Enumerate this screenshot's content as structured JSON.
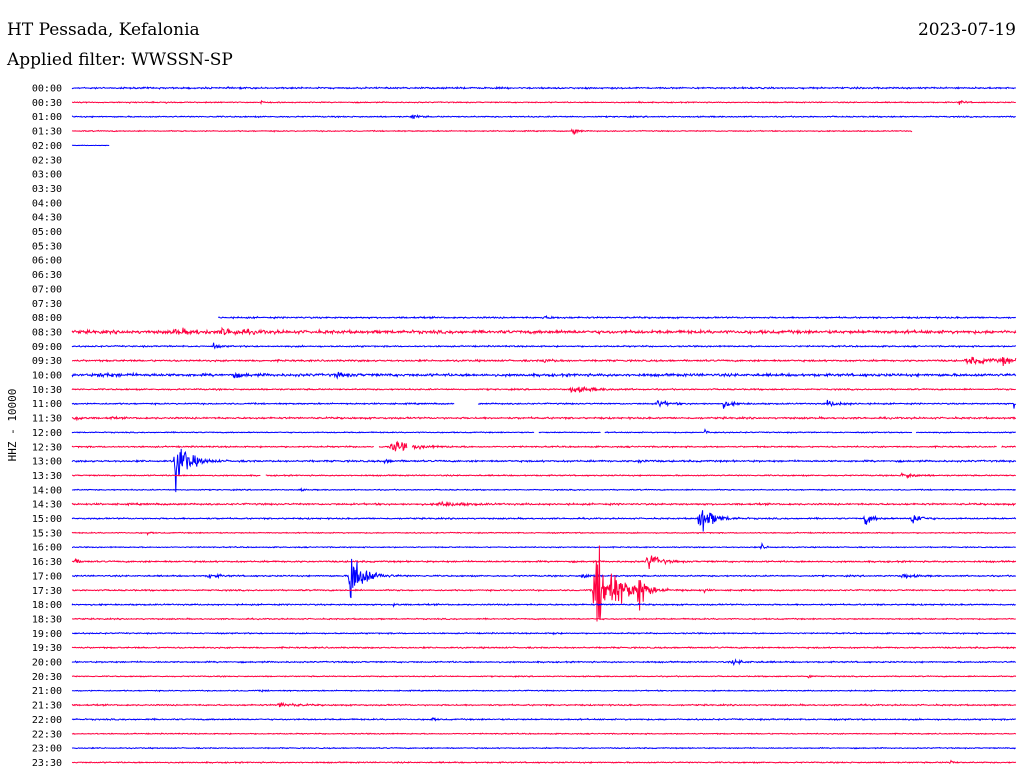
{
  "header": {
    "station": "HT Pessada, Kefalonia",
    "date": "2023-07-19",
    "filter": "Applied filter: WWSSN-SP"
  },
  "chart_data": {
    "type": "line",
    "title": "",
    "ylabel": "HHZ - 10000",
    "colors": [
      "#0000ff",
      "#ff0040"
    ],
    "grid": false,
    "rows": [
      {
        "label": "00:00",
        "start": 0.0,
        "end": 1.0,
        "noise": 0.9,
        "events": [],
        "gaps": []
      },
      {
        "label": "00:30",
        "start": 0.0,
        "end": 1.0,
        "noise": 0.6,
        "events": [
          {
            "t": 0.06,
            "amp": 2,
            "dur": 0.004
          },
          {
            "t": 0.1,
            "amp": 2,
            "dur": 0.004
          },
          {
            "t": 0.2,
            "amp": 2,
            "dur": 0.004
          },
          {
            "t": 0.6,
            "amp": 2,
            "dur": 0.004
          },
          {
            "t": 0.94,
            "amp": 3,
            "dur": 0.01
          }
        ],
        "gaps": []
      },
      {
        "label": "01:00",
        "start": 0.0,
        "end": 1.0,
        "noise": 0.7,
        "events": [
          {
            "t": 0.36,
            "amp": 5,
            "dur": 0.01
          }
        ],
        "gaps": []
      },
      {
        "label": "01:30",
        "start": 0.0,
        "end": 0.89,
        "noise": 0.6,
        "events": [
          {
            "t": 0.53,
            "amp": 6,
            "dur": 0.01
          }
        ],
        "gaps": []
      },
      {
        "label": "02:00",
        "start": 0.0,
        "end": 0.04,
        "noise": 0.3,
        "events": [],
        "gaps": []
      },
      {
        "label": "02:30",
        "start": 0,
        "end": 0,
        "noise": 0,
        "events": [],
        "gaps": []
      },
      {
        "label": "03:00",
        "start": 0,
        "end": 0,
        "noise": 0,
        "events": [],
        "gaps": []
      },
      {
        "label": "03:30",
        "start": 0,
        "end": 0,
        "noise": 0,
        "events": [],
        "gaps": []
      },
      {
        "label": "04:00",
        "start": 0,
        "end": 0,
        "noise": 0,
        "events": [],
        "gaps": []
      },
      {
        "label": "04:30",
        "start": 0,
        "end": 0,
        "noise": 0,
        "events": [],
        "gaps": []
      },
      {
        "label": "05:00",
        "start": 0,
        "end": 0,
        "noise": 0,
        "events": [],
        "gaps": []
      },
      {
        "label": "05:30",
        "start": 0,
        "end": 0,
        "noise": 0,
        "events": [],
        "gaps": []
      },
      {
        "label": "06:00",
        "start": 0,
        "end": 0,
        "noise": 0,
        "events": [],
        "gaps": []
      },
      {
        "label": "06:30",
        "start": 0,
        "end": 0,
        "noise": 0,
        "events": [],
        "gaps": []
      },
      {
        "label": "07:00",
        "start": 0,
        "end": 0,
        "noise": 0,
        "events": [],
        "gaps": []
      },
      {
        "label": "07:30",
        "start": 0,
        "end": 0,
        "noise": 0,
        "events": [],
        "gaps": []
      },
      {
        "label": "08:00",
        "start": 0.155,
        "end": 1.0,
        "noise": 0.9,
        "events": [
          {
            "t": 0.5,
            "amp": 1.5,
            "dur": 0.02
          }
        ],
        "gaps": []
      },
      {
        "label": "08:30",
        "start": 0.0,
        "end": 1.0,
        "noise": 1.8,
        "events": [
          {
            "t": 0.11,
            "amp": 3,
            "dur": 0.04
          },
          {
            "t": 0.16,
            "amp": 4,
            "dur": 0.04
          }
        ],
        "gaps": []
      },
      {
        "label": "09:00",
        "start": 0.0,
        "end": 1.0,
        "noise": 0.8,
        "events": [
          {
            "t": 0.15,
            "amp": 3,
            "dur": 0.01
          }
        ],
        "gaps": []
      },
      {
        "label": "09:30",
        "start": 0.0,
        "end": 1.0,
        "noise": 1.0,
        "events": [
          {
            "t": 0.5,
            "amp": 2,
            "dur": 0.02
          },
          {
            "t": 0.95,
            "amp": 4,
            "dur": 0.05
          },
          {
            "t": 0.985,
            "amp": 5,
            "dur": 0.02
          }
        ],
        "gaps": []
      },
      {
        "label": "10:00",
        "start": 0.0,
        "end": 1.0,
        "noise": 1.5,
        "events": [
          {
            "t": 0.03,
            "amp": 2,
            "dur": 0.04
          },
          {
            "t": 0.17,
            "amp": 3,
            "dur": 0.02
          },
          {
            "t": 0.28,
            "amp": 3,
            "dur": 0.02
          }
        ],
        "gaps": []
      },
      {
        "label": "10:30",
        "start": 0.0,
        "end": 1.0,
        "noise": 0.8,
        "events": [
          {
            "t": 0.53,
            "amp": 4,
            "dur": 0.04
          }
        ],
        "gaps": []
      },
      {
        "label": "11:00",
        "start": 0.0,
        "end": 1.0,
        "noise": 0.8,
        "events": [
          {
            "t": 0.62,
            "amp": 5,
            "dur": 0.02
          },
          {
            "t": 0.69,
            "amp": 4,
            "dur": 0.02
          },
          {
            "t": 0.8,
            "amp": 3,
            "dur": 0.03
          },
          {
            "t": 0.998,
            "amp": 6,
            "dur": 0.004
          }
        ],
        "gaps": [
          [
            0.405,
            0.43
          ]
        ]
      },
      {
        "label": "11:30",
        "start": 0.0,
        "end": 1.0,
        "noise": 1.0,
        "events": [
          {
            "t": 0.003,
            "amp": 6,
            "dur": 0.008
          },
          {
            "t": 0.04,
            "amp": 2,
            "dur": 0.006
          }
        ],
        "gaps": []
      },
      {
        "label": "12:00",
        "start": 0.0,
        "end": 1.0,
        "noise": 0.6,
        "events": [
          {
            "t": 0.67,
            "amp": 3,
            "dur": 0.01
          }
        ],
        "gaps": [
          [
            0.49,
            0.494
          ],
          [
            0.56,
            0.564
          ],
          [
            0.89,
            0.894
          ]
        ]
      },
      {
        "label": "12:30",
        "start": 0.0,
        "end": 1.0,
        "noise": 0.8,
        "events": [
          {
            "t": 0.34,
            "amp": 7,
            "dur": 0.04
          }
        ],
        "gaps": [
          [
            0.32,
            0.325
          ],
          [
            0.355,
            0.36
          ],
          [
            0.98,
            0.984
          ]
        ]
      },
      {
        "label": "13:00",
        "start": 0.0,
        "end": 1.0,
        "noise": 1.0,
        "events": [
          {
            "t": 0.11,
            "amp": 30,
            "dur": 0.025
          },
          {
            "t": 0.33,
            "amp": 2,
            "dur": 0.02
          },
          {
            "t": 0.6,
            "amp": 2,
            "dur": 0.015
          }
        ],
        "gaps": []
      },
      {
        "label": "13:30",
        "start": 0.0,
        "end": 1.0,
        "noise": 0.7,
        "events": [
          {
            "t": 0.88,
            "amp": 5,
            "dur": 0.02
          }
        ],
        "gaps": [
          [
            0.2,
            0.205
          ]
        ]
      },
      {
        "label": "14:00",
        "start": 0.0,
        "end": 1.0,
        "noise": 0.6,
        "events": [
          {
            "t": 0.24,
            "amp": 2,
            "dur": 0.008
          }
        ],
        "gaps": []
      },
      {
        "label": "14:30",
        "start": 0.0,
        "end": 1.0,
        "noise": 1.0,
        "events": [
          {
            "t": 0.39,
            "amp": 3,
            "dur": 0.04
          }
        ],
        "gaps": []
      },
      {
        "label": "15:00",
        "start": 0.0,
        "end": 1.0,
        "noise": 0.8,
        "events": [
          {
            "t": 0.665,
            "amp": 20,
            "dur": 0.025
          },
          {
            "t": 0.84,
            "amp": 8,
            "dur": 0.015
          },
          {
            "t": 0.89,
            "amp": 10,
            "dur": 0.015
          }
        ],
        "gaps": []
      },
      {
        "label": "15:30",
        "start": 0.0,
        "end": 1.0,
        "noise": 0.6,
        "events": [
          {
            "t": 0.08,
            "amp": 3,
            "dur": 0.004
          }
        ],
        "gaps": []
      },
      {
        "label": "16:00",
        "start": 0.0,
        "end": 1.0,
        "noise": 0.6,
        "events": [
          {
            "t": 0.73,
            "amp": 4,
            "dur": 0.01
          }
        ],
        "gaps": []
      },
      {
        "label": "16:30",
        "start": 0.0,
        "end": 1.0,
        "noise": 0.9,
        "events": [
          {
            "t": 0.003,
            "amp": 3,
            "dur": 0.01
          },
          {
            "t": 0.61,
            "amp": 12,
            "dur": 0.02
          }
        ],
        "gaps": []
      },
      {
        "label": "17:00",
        "start": 0.0,
        "end": 1.0,
        "noise": 0.8,
        "events": [
          {
            "t": 0.145,
            "amp": 3,
            "dur": 0.02
          },
          {
            "t": 0.295,
            "amp": 38,
            "dur": 0.025
          },
          {
            "t": 0.54,
            "amp": 3,
            "dur": 0.02
          },
          {
            "t": 0.88,
            "amp": 3,
            "dur": 0.02
          }
        ],
        "gaps": []
      },
      {
        "label": "17:30",
        "start": 0.0,
        "end": 1.0,
        "noise": 0.8,
        "events": [
          {
            "t": 0.555,
            "amp": 60,
            "dur": 0.04
          },
          {
            "t": 0.6,
            "amp": 35,
            "dur": 0.01
          },
          {
            "t": 0.67,
            "amp": 3,
            "dur": 0.004
          }
        ],
        "gaps": []
      },
      {
        "label": "18:00",
        "start": 0.0,
        "end": 1.0,
        "noise": 0.8,
        "events": [
          {
            "t": 0.34,
            "amp": 3,
            "dur": 0.006
          }
        ],
        "gaps": []
      },
      {
        "label": "18:30",
        "start": 0.0,
        "end": 1.0,
        "noise": 0.7,
        "events": [],
        "gaps": []
      },
      {
        "label": "19:00",
        "start": 0.0,
        "end": 1.0,
        "noise": 0.7,
        "events": [
          {
            "t": 0.51,
            "amp": 2,
            "dur": 0.006
          }
        ],
        "gaps": []
      },
      {
        "label": "19:30",
        "start": 0.0,
        "end": 1.0,
        "noise": 0.8,
        "events": [],
        "gaps": []
      },
      {
        "label": "20:00",
        "start": 0.0,
        "end": 1.0,
        "noise": 0.8,
        "events": [
          {
            "t": 0.7,
            "amp": 2,
            "dur": 0.03
          }
        ],
        "gaps": []
      },
      {
        "label": "20:30",
        "start": 0.0,
        "end": 1.0,
        "noise": 0.6,
        "events": [
          {
            "t": 0.78,
            "amp": 3,
            "dur": 0.006
          }
        ],
        "gaps": []
      },
      {
        "label": "21:00",
        "start": 0.0,
        "end": 1.0,
        "noise": 0.6,
        "events": [
          {
            "t": 0.2,
            "amp": 2,
            "dur": 0.006
          }
        ],
        "gaps": []
      },
      {
        "label": "21:30",
        "start": 0.0,
        "end": 1.0,
        "noise": 0.8,
        "events": [
          {
            "t": 0.22,
            "amp": 3,
            "dur": 0.03
          }
        ],
        "gaps": []
      },
      {
        "label": "22:00",
        "start": 0.0,
        "end": 1.0,
        "noise": 0.8,
        "events": [
          {
            "t": 0.38,
            "amp": 3,
            "dur": 0.006
          }
        ],
        "gaps": []
      },
      {
        "label": "22:30",
        "start": 0.0,
        "end": 1.0,
        "noise": 0.6,
        "events": [],
        "gaps": []
      },
      {
        "label": "23:00",
        "start": 0.0,
        "end": 1.0,
        "noise": 0.6,
        "events": [],
        "gaps": []
      },
      {
        "label": "23:30",
        "start": 0.0,
        "end": 1.0,
        "noise": 0.7,
        "events": [
          {
            "t": 0.93,
            "amp": 4,
            "dur": 0.006
          }
        ],
        "gaps": []
      }
    ]
  }
}
